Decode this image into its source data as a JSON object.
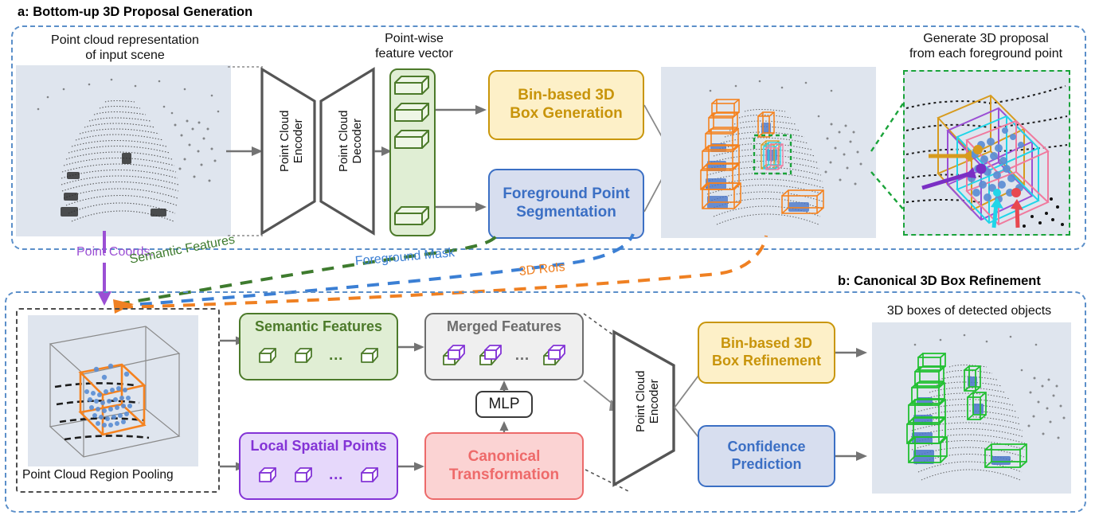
{
  "sections": {
    "a": {
      "title": "a: Bottom-up 3D Proposal Generation"
    },
    "b": {
      "title": "b: Canonical 3D Box Refinement"
    }
  },
  "captions": {
    "input_cloud": "Point cloud representation\nof input scene",
    "feature_vector": "Point-wise\nfeature vector",
    "zoom_proposal": "Generate 3D proposal\nfrom each foreground point",
    "region_pooling": "Point Cloud Region Pooling",
    "detected_boxes": "3D boxes of detected objects"
  },
  "blocks": {
    "encoder_a": "Point Cloud\nEncoder",
    "decoder_a": "Point Cloud\nDecoder",
    "encoder_b": "Point Cloud\nEncoder",
    "bin_box_generation": "Bin-based 3D\nBox Generation",
    "foreground_segmentation": "Foreground Point\nSegmentation",
    "semantic_features": "Semantic Features",
    "merged_features": "Merged Features",
    "local_spatial_points": "Local Spatial Points",
    "canonical_transformation": "Canonical\nTransformation",
    "mlp": "MLP",
    "bin_box_refinement": "Bin-based 3D\nBox Refinement",
    "confidence_prediction": "Confidence\nPrediction"
  },
  "connectors": [
    {
      "id": "point-coords",
      "label": "Point Coords.",
      "color": "#9b4fd4"
    },
    {
      "id": "semantic-features",
      "label": "Semantic Features",
      "color": "#3e7b2e"
    },
    {
      "id": "foreground-mask",
      "label": "Foreground Mask",
      "color": "#3b7fd4"
    },
    {
      "id": "3d-rois",
      "label": "3D RoIs",
      "color": "#ef8022"
    }
  ],
  "colors": {
    "panel_border": "#5b8fc9",
    "yellow": "#c8940a",
    "blue": "#3b6fc4",
    "green": "#4c7a2a",
    "gray": "#6d6d6d",
    "purple": "#8333d6",
    "red": "#ee6a6a",
    "orange": "#ef8022",
    "detection_green": "#22c032",
    "arrow": "#737373",
    "cloud_bg": "#dfe5ee"
  },
  "ellipsis": "…",
  "proposal_box_colors": [
    "#d79b1e",
    "#9b4fd4",
    "#20d5e8",
    "#f07a9e"
  ]
}
